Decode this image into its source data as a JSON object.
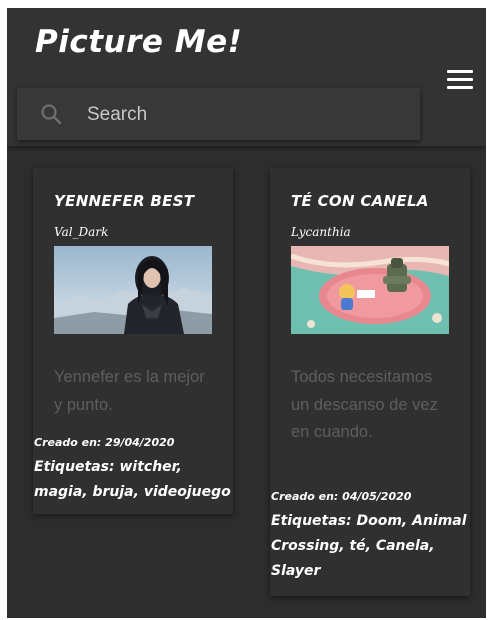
{
  "header": {
    "title": "Picture Me!",
    "menu_icon": "hamburger-menu-icon"
  },
  "search": {
    "placeholder": "Search",
    "icon": "search-icon"
  },
  "posts": [
    {
      "title": "YENNEFER BEST",
      "author": "Val_Dark",
      "description": "Yennefer es la mejor y punto.",
      "date": "Creado en: 29/04/2020",
      "tags": "Etiquetas: witcher, magia, bruja, videojuego"
    },
    {
      "title": "TÉ CON CANELA",
      "author": "Lycanthia",
      "description": "Todos necesitamos un descanso de vez en cuando.",
      "date": "Creado en: 04/05/2020",
      "tags": "Etiquetas: Doom, Animal Crossing, té, Canela, Slayer"
    }
  ],
  "colors": {
    "background": "#2d2d2d",
    "header": "#333333",
    "card": "#303030",
    "description_text": "#5e5e5e"
  }
}
